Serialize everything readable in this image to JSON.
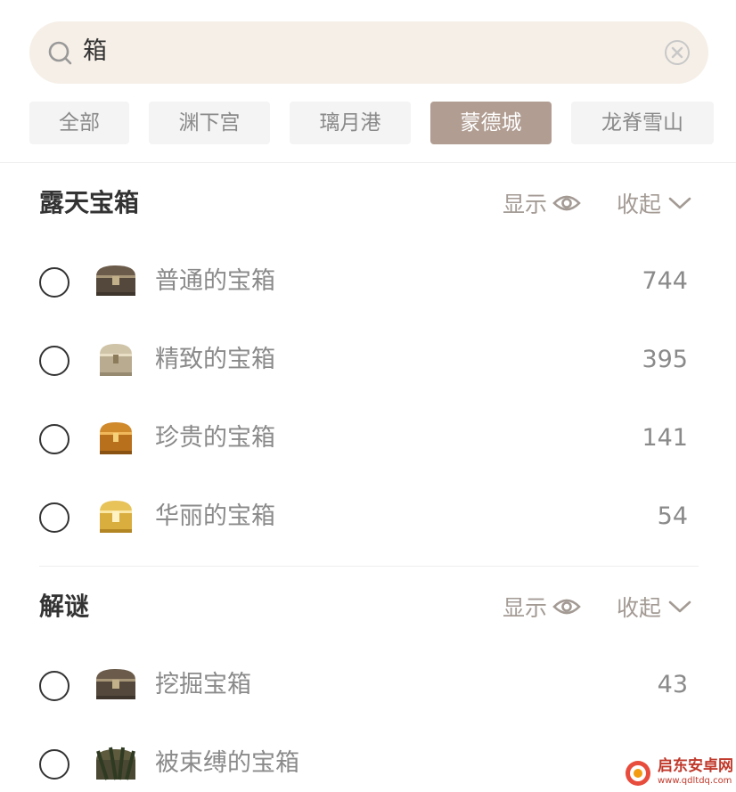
{
  "search": {
    "value": "箱"
  },
  "tabs": [
    {
      "label": "全部"
    },
    {
      "label": "渊下宫"
    },
    {
      "label": "璃月港"
    },
    {
      "label": "蒙德城",
      "active": true
    },
    {
      "label": "龙脊雪山"
    }
  ],
  "sections": [
    {
      "title": "露天宝箱",
      "show_label": "显示",
      "collapse_label": "收起",
      "items": [
        {
          "label": "普通的宝箱",
          "count": "744",
          "icon": "common-chest-icon"
        },
        {
          "label": "精致的宝箱",
          "count": "395",
          "icon": "exquisite-chest-icon"
        },
        {
          "label": "珍贵的宝箱",
          "count": "141",
          "icon": "precious-chest-icon"
        },
        {
          "label": "华丽的宝箱",
          "count": "54",
          "icon": "luxurious-chest-icon"
        }
      ]
    },
    {
      "title": "解谜",
      "show_label": "显示",
      "collapse_label": "收起",
      "items": [
        {
          "label": "挖掘宝箱",
          "count": "43",
          "icon": "dig-chest-icon"
        },
        {
          "label": "被束缚的宝箱",
          "count": "",
          "icon": "bound-chest-icon"
        }
      ]
    }
  ],
  "watermark": {
    "title": "启东安卓网",
    "url": "www.qdltdq.com"
  },
  "colors": {
    "accent": "#b19d92",
    "search_bg": "#f6efe7",
    "tab_bg": "#f4f4f4",
    "muted_text": "#8a8a8a"
  }
}
